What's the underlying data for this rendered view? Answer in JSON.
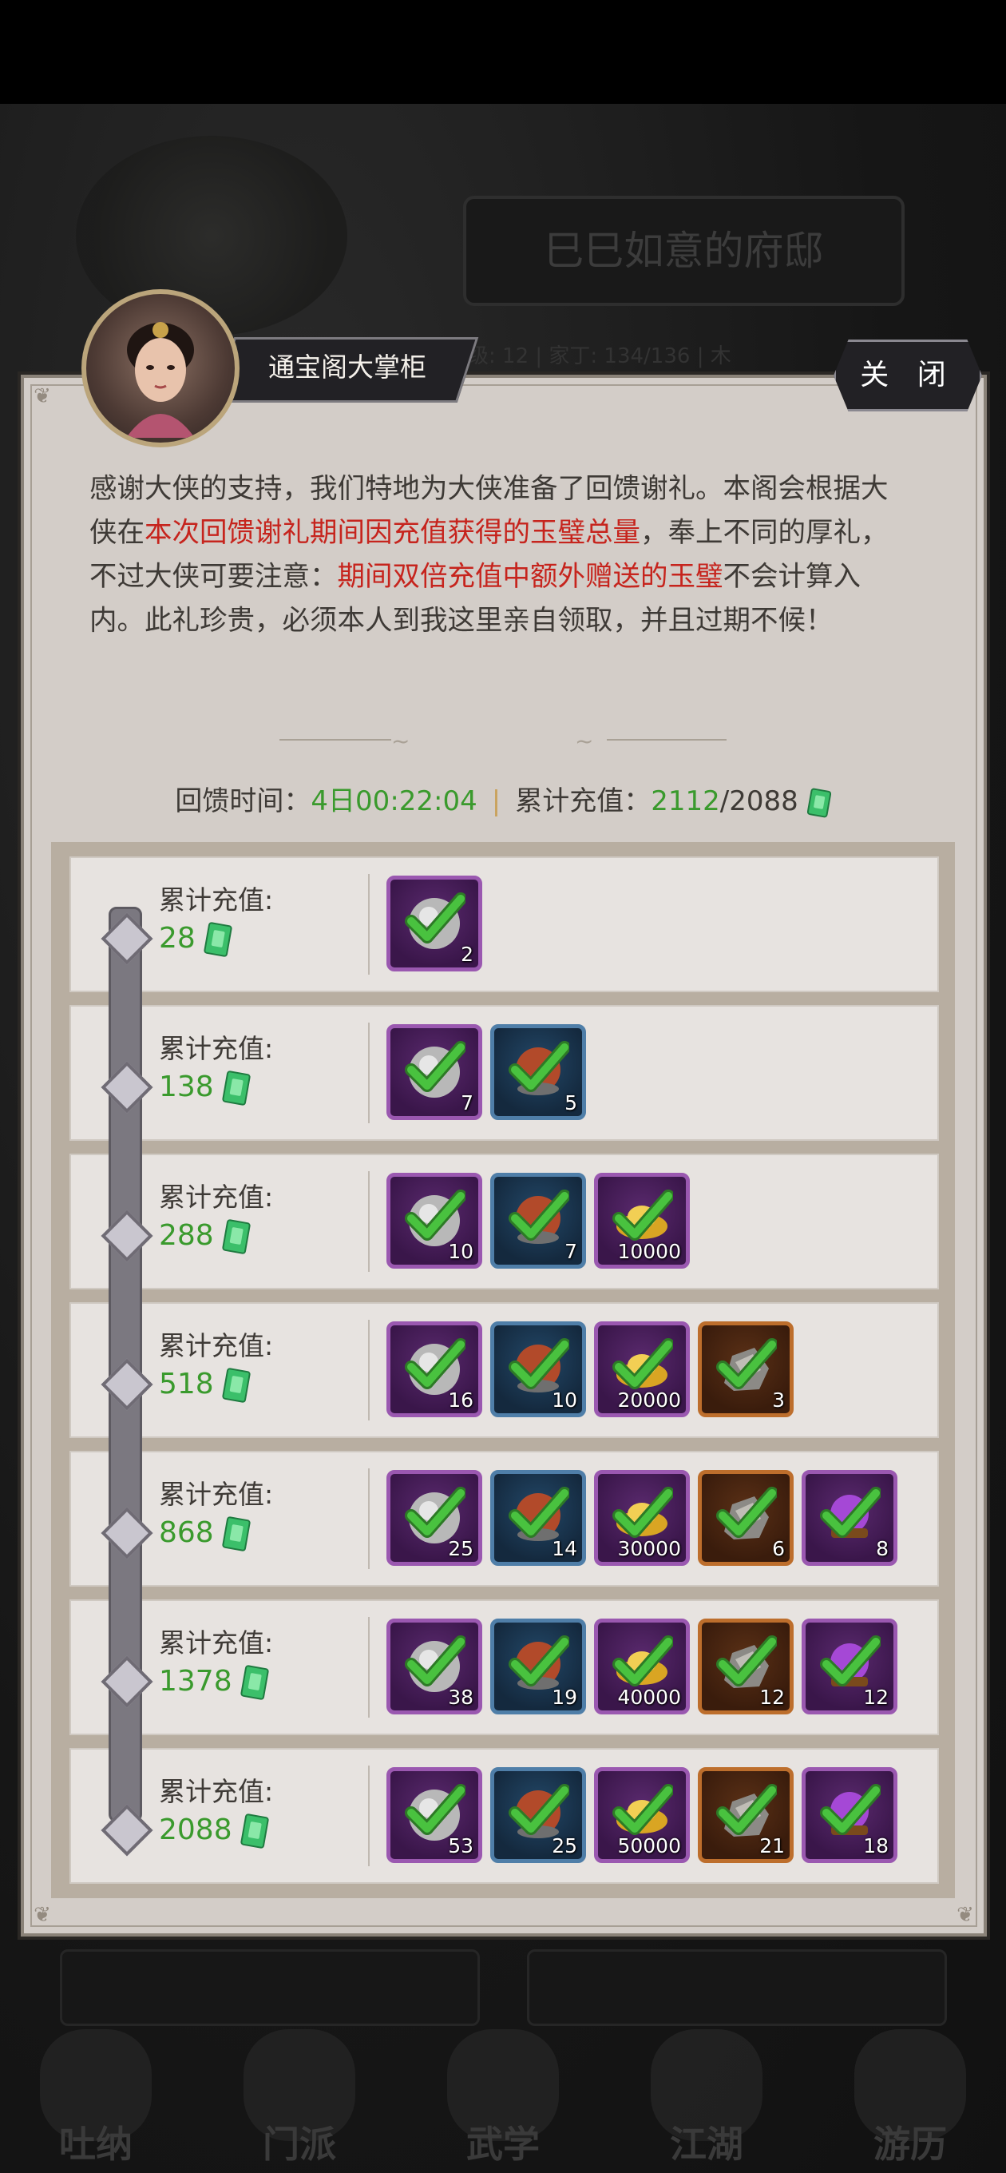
{
  "background": {
    "residence_title": "巳巳如意的府邸",
    "stats_text": "等级: 12   |   家丁: 134/136   |   木",
    "nav": [
      "吐纳",
      "门派",
      "武学",
      "江湖",
      "游历"
    ]
  },
  "npc": {
    "name": "通宝阁大掌柜"
  },
  "close_label": "关 闭",
  "intro": {
    "part1": "感谢大侠的支持，我们特地为大侠准备了回馈谢礼。本阁会根据大侠在",
    "red1": "本次回馈谢礼期间因充值获得的玉璧总量",
    "part2": "，奉上不同的厚礼，不过大侠可要注意：",
    "red2": "期间双倍充值中额外赠送的玉璧",
    "part3": "不会计算入内。此礼珍贵，必须本人到我这里亲自领取，并且过期不候！"
  },
  "summary": {
    "time_label": "回馈时间：",
    "time_value": "4日00:22:04",
    "separator": "|",
    "recharge_label": "累计充值：",
    "recharge_current": "2112",
    "recharge_target": "/2088"
  },
  "tiers": [
    {
      "label": "累计充值:",
      "amount": "28",
      "rewards": [
        {
          "type": "silver",
          "frame": "purple",
          "qty": "2"
        }
      ]
    },
    {
      "label": "累计充值:",
      "amount": "138",
      "rewards": [
        {
          "type": "silver",
          "frame": "purple",
          "qty": "7"
        },
        {
          "type": "food",
          "frame": "blue",
          "qty": "5"
        }
      ]
    },
    {
      "label": "累计充值:",
      "amount": "288",
      "rewards": [
        {
          "type": "silver",
          "frame": "purple",
          "qty": "10"
        },
        {
          "type": "food",
          "frame": "blue",
          "qty": "7"
        },
        {
          "type": "gold",
          "frame": "purple",
          "qty": "10000"
        }
      ]
    },
    {
      "label": "累计充值:",
      "amount": "518",
      "rewards": [
        {
          "type": "silver",
          "frame": "purple",
          "qty": "16"
        },
        {
          "type": "food",
          "frame": "blue",
          "qty": "10"
        },
        {
          "type": "gold",
          "frame": "purple",
          "qty": "20000"
        },
        {
          "type": "ore",
          "frame": "orange",
          "qty": "3"
        }
      ]
    },
    {
      "label": "累计充值:",
      "amount": "868",
      "rewards": [
        {
          "type": "silver",
          "frame": "purple",
          "qty": "25"
        },
        {
          "type": "food",
          "frame": "blue",
          "qty": "14"
        },
        {
          "type": "gold",
          "frame": "purple",
          "qty": "30000"
        },
        {
          "type": "ore",
          "frame": "orange",
          "qty": "6"
        },
        {
          "type": "gem",
          "frame": "purple",
          "qty": "8"
        }
      ]
    },
    {
      "label": "累计充值:",
      "amount": "1378",
      "rewards": [
        {
          "type": "silver",
          "frame": "purple",
          "qty": "38"
        },
        {
          "type": "food",
          "frame": "blue",
          "qty": "19"
        },
        {
          "type": "gold",
          "frame": "purple",
          "qty": "40000"
        },
        {
          "type": "ore",
          "frame": "orange",
          "qty": "12"
        },
        {
          "type": "gem",
          "frame": "purple",
          "qty": "12"
        }
      ]
    },
    {
      "label": "累计充值:",
      "amount": "2088",
      "rewards": [
        {
          "type": "silver",
          "frame": "purple",
          "qty": "53"
        },
        {
          "type": "food",
          "frame": "blue",
          "qty": "25"
        },
        {
          "type": "gold",
          "frame": "purple",
          "qty": "50000"
        },
        {
          "type": "ore",
          "frame": "orange",
          "qty": "21"
        },
        {
          "type": "gem",
          "frame": "purple",
          "qty": "18"
        }
      ]
    }
  ],
  "colors": {
    "green": "#3a9a2d",
    "red": "#c6241d",
    "check": "#49c23f"
  }
}
